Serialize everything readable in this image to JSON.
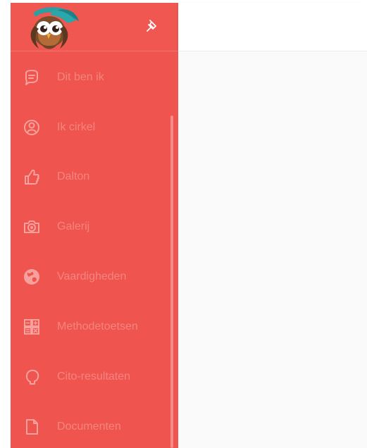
{
  "sidebar": {
    "logo_name": "owl-logo",
    "pin_icon": "pin-icon",
    "items": [
      {
        "label": "Dit ben ik",
        "icon": "speech-bubble-icon"
      },
      {
        "label": "Ik cirkel",
        "icon": "person-circle-icon"
      },
      {
        "label": "Dalton",
        "icon": "thumbs-up-icon"
      },
      {
        "label": "Galerij",
        "icon": "camera-icon"
      },
      {
        "label": "Vaardigheden",
        "icon": "globe-icon"
      },
      {
        "label": "Methodetoetsen",
        "icon": "calculator-icon"
      },
      {
        "label": "Cito-resultaten",
        "icon": "head-profile-icon"
      },
      {
        "label": "Documenten",
        "icon": "document-icon"
      }
    ]
  },
  "colors": {
    "sidebar": "#ef554e",
    "topbar": "#ffffff",
    "content": "#fafafa",
    "icon": "#f6a19d",
    "label": "#f59f9b"
  }
}
